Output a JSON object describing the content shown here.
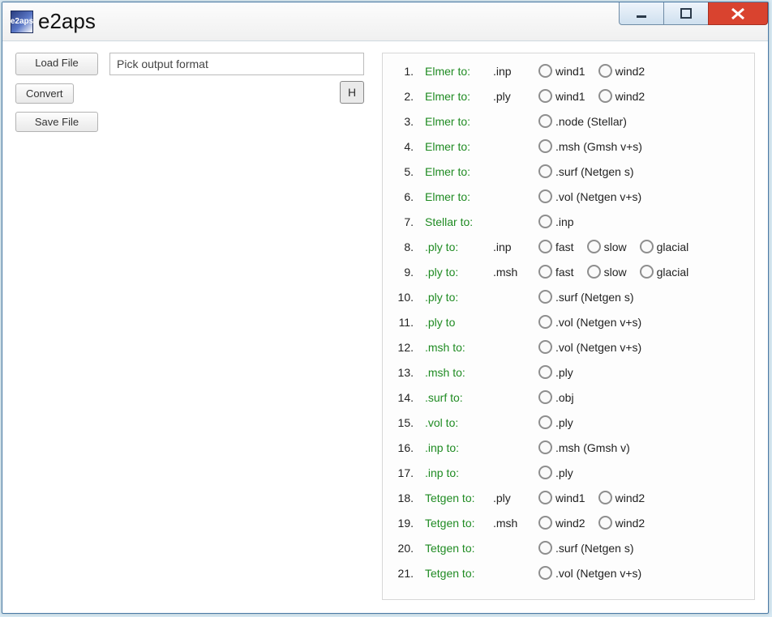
{
  "titlebar": {
    "icon_text": "e2aps",
    "app_name": "e2aps"
  },
  "left": {
    "load_file": "Load File",
    "convert": "Convert",
    "save_file": "Save File",
    "output_label": "Pick output format",
    "h_btn": "H"
  },
  "rows": [
    {
      "n": "1.",
      "src": "Elmer to:",
      "ext": ".inp",
      "opts": [
        "wind1",
        "wind2"
      ]
    },
    {
      "n": "2.",
      "src": "Elmer to:",
      "ext": ".ply",
      "opts": [
        "wind1",
        "wind2"
      ]
    },
    {
      "n": "3.",
      "src": "Elmer to:",
      "ext": "",
      "opts": [
        ".node (Stellar)"
      ]
    },
    {
      "n": "4.",
      "src": "Elmer to:",
      "ext": "",
      "opts": [
        ".msh (Gmsh v+s)"
      ]
    },
    {
      "n": "5.",
      "src": "Elmer to:",
      "ext": "",
      "opts": [
        ".surf (Netgen s)"
      ]
    },
    {
      "n": "6.",
      "src": "Elmer to:",
      "ext": "",
      "opts": [
        ".vol (Netgen v+s)"
      ]
    },
    {
      "n": "7.",
      "src": "Stellar to:",
      "ext": "",
      "opts": [
        ".inp"
      ]
    },
    {
      "n": "8.",
      "src": ".ply to:",
      "ext": ".inp",
      "opts": [
        "fast",
        "slow",
        "glacial"
      ]
    },
    {
      "n": "9.",
      "src": ".ply to:",
      "ext": ".msh",
      "opts": [
        "fast",
        "slow",
        "glacial"
      ]
    },
    {
      "n": "10.",
      "src": ".ply to:",
      "ext": "",
      "opts": [
        ".surf (Netgen s)"
      ]
    },
    {
      "n": "11.",
      "src": ".ply to",
      "ext": "",
      "opts": [
        ".vol (Netgen v+s)"
      ]
    },
    {
      "n": "12.",
      "src": ".msh to:",
      "ext": "",
      "opts": [
        ".vol (Netgen v+s)"
      ]
    },
    {
      "n": "13.",
      "src": ".msh to:",
      "ext": "",
      "opts": [
        ".ply"
      ]
    },
    {
      "n": "14.",
      "src": ".surf to:",
      "ext": "",
      "opts": [
        ".obj"
      ]
    },
    {
      "n": "15.",
      "src": ".vol to:",
      "ext": "",
      "opts": [
        ".ply"
      ]
    },
    {
      "n": "16.",
      "src": ".inp to:",
      "ext": "",
      "opts": [
        ".msh (Gmsh v)"
      ]
    },
    {
      "n": "17.",
      "src": ".inp to:",
      "ext": "",
      "opts": [
        ".ply"
      ]
    },
    {
      "n": "18.",
      "src": "Tetgen to:",
      "ext": ".ply",
      "opts": [
        "wind1",
        "wind2"
      ]
    },
    {
      "n": "19.",
      "src": "Tetgen to:",
      "ext": ".msh",
      "opts": [
        "wind2",
        "wind2"
      ]
    },
    {
      "n": "20.",
      "src": "Tetgen to:",
      "ext": "",
      "opts": [
        ".surf (Netgen s)"
      ]
    },
    {
      "n": "21.",
      "src": "Tetgen to:",
      "ext": "",
      "opts": [
        ".vol (Netgen v+s)"
      ]
    }
  ]
}
